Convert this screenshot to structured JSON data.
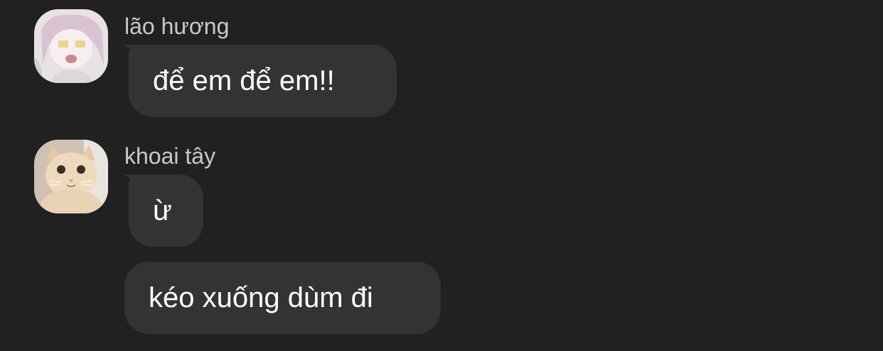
{
  "messages": [
    {
      "sender": "lão hương",
      "avatar_icon": "anime-girl-avatar",
      "text": "để em để em!!"
    },
    {
      "sender": "khoai tây",
      "avatar_icon": "cat-avatar",
      "text": "ừ"
    },
    {
      "sender": "khoai tây",
      "text": "kéo xuống dùm đi"
    }
  ],
  "colors": {
    "background": "#212121",
    "bubble": "#333333",
    "sender_name": "#c9c9c9",
    "text": "#ffffff"
  }
}
